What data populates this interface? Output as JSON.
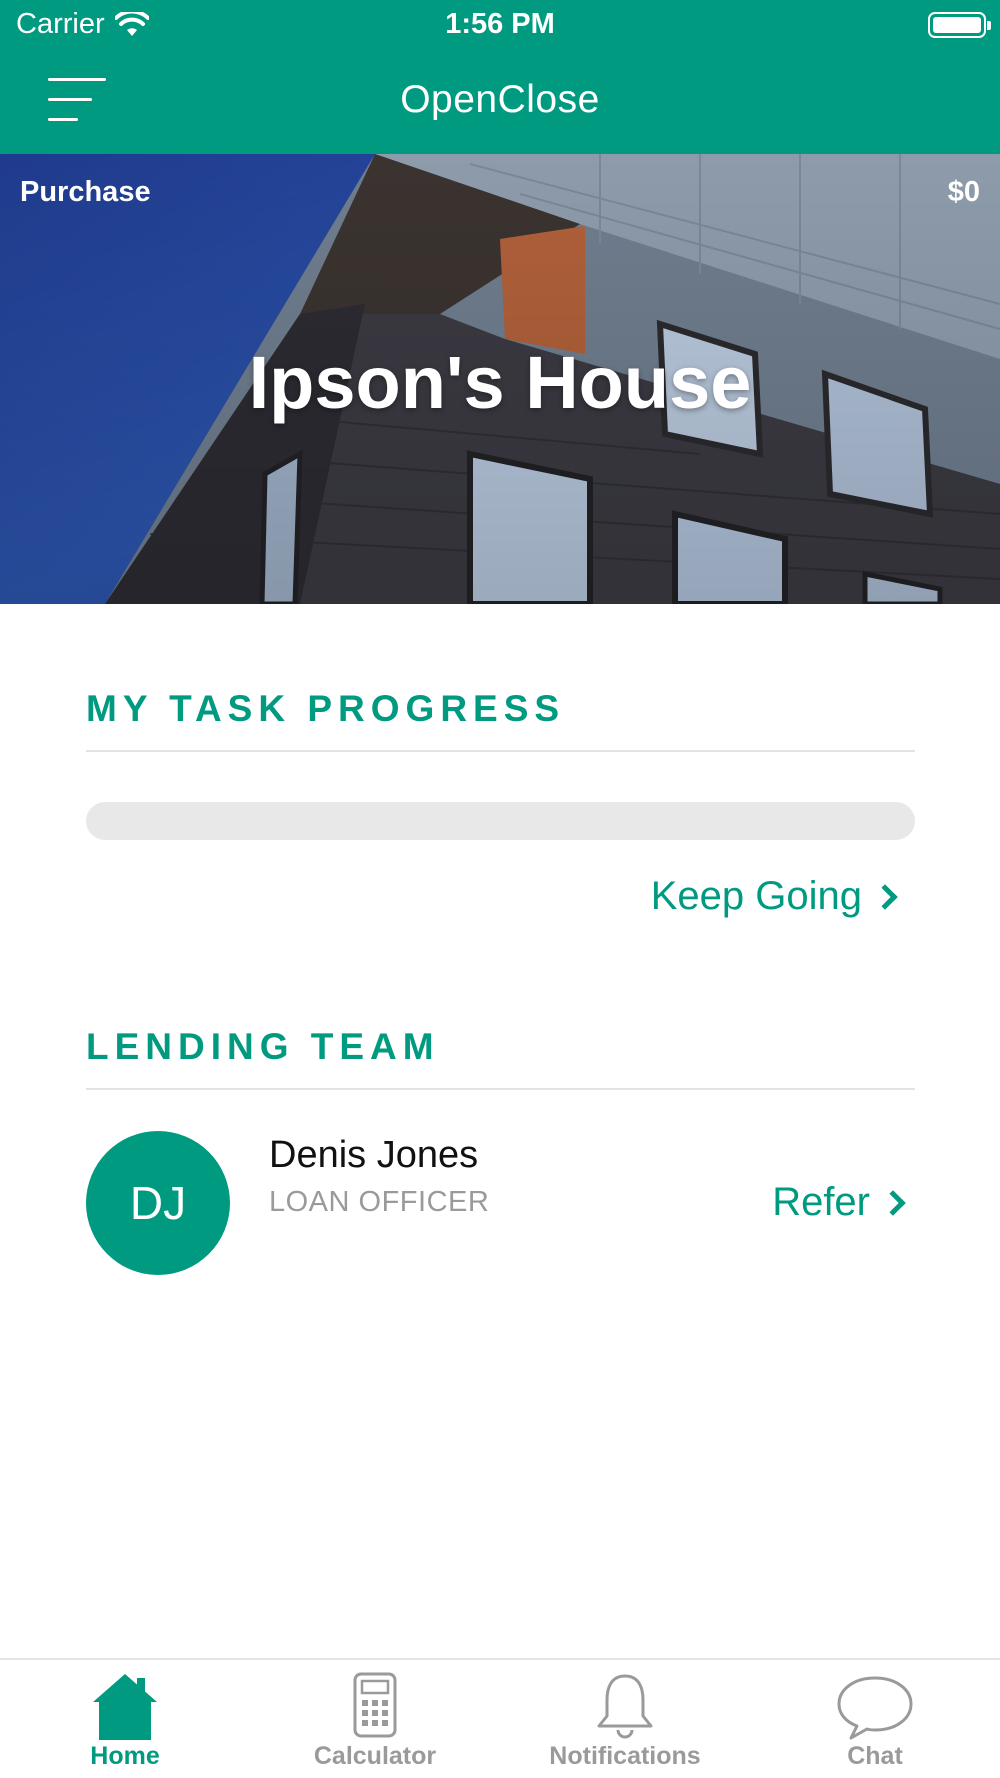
{
  "status_bar": {
    "carrier": "Carrier",
    "time": "1:56 PM",
    "wifi_icon": "wifi-icon",
    "battery_icon": "battery-icon"
  },
  "nav": {
    "menu_icon": "hamburger-menu-icon",
    "title": "OpenClose"
  },
  "hero": {
    "loan_type": "Purchase",
    "amount": "$0",
    "title": "Ipson's House",
    "background": "building-photo"
  },
  "task_progress": {
    "heading": "MY TASK PROGRESS",
    "progress": 0,
    "keep_going_label": "Keep Going"
  },
  "lending_team": {
    "heading": "LENDING TEAM",
    "members": [
      {
        "initials": "DJ",
        "name": "Denis Jones",
        "role": "LOAN OFFICER",
        "refer_label": "Refer"
      }
    ]
  },
  "tabs": [
    {
      "label": "Home",
      "icon": "home-icon",
      "active": true
    },
    {
      "label": "Calculator",
      "icon": "calculator-icon",
      "active": false
    },
    {
      "label": "Notifications",
      "icon": "bell-icon",
      "active": false
    },
    {
      "label": "Chat",
      "icon": "chat-bubble-icon",
      "active": false
    }
  ],
  "colors": {
    "accent": "#009a80",
    "divider": "#e3e3e3",
    "progress_track": "#e8e8e8",
    "inactive_tab": "#9a9a9a"
  }
}
